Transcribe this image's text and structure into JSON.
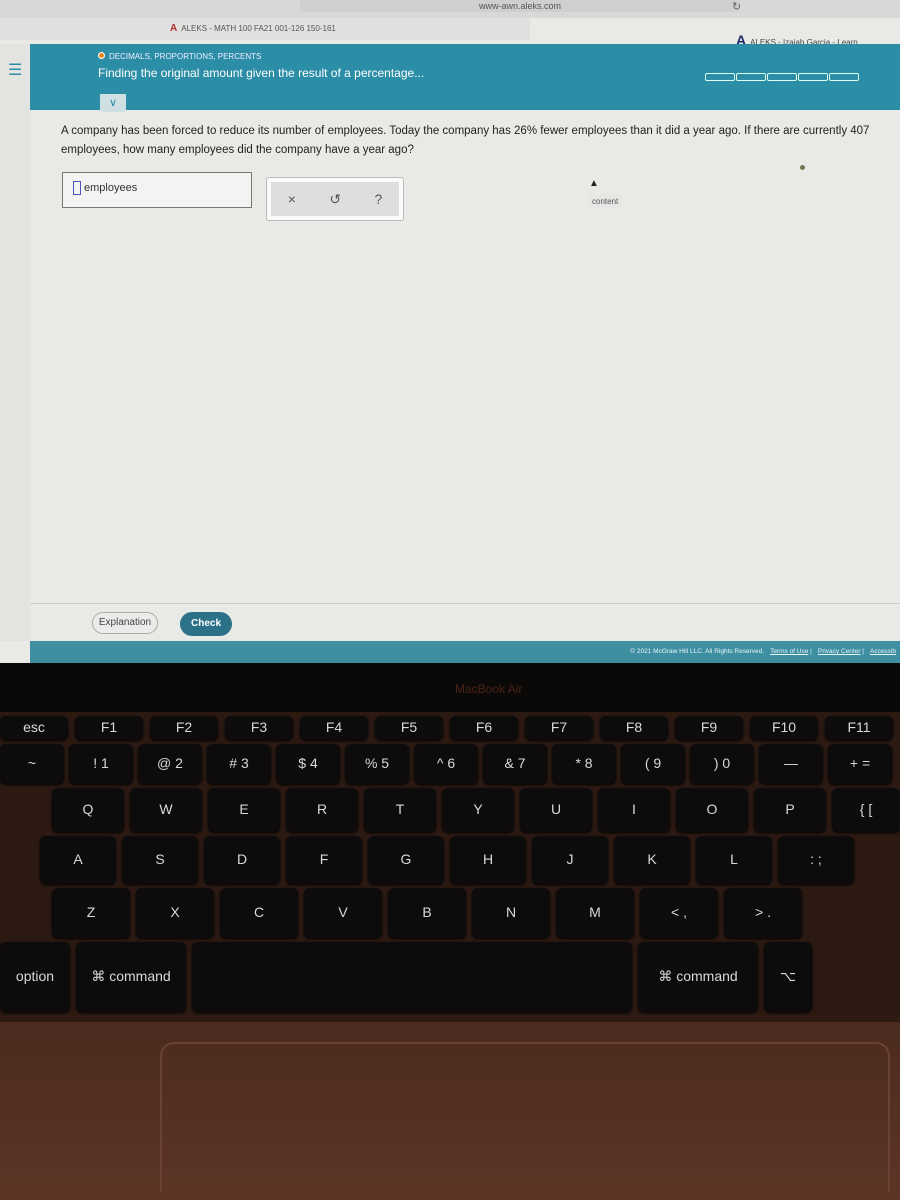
{
  "browser": {
    "url": "www-awn.aleks.com",
    "reload_icon": "reload-icon"
  },
  "tabs": [
    {
      "label": "ALEKS - MATH 100 FA21 001-126 150-161"
    },
    {
      "label": "ALEKS - Izaiah Garcia - Learn"
    }
  ],
  "header": {
    "topic": "DECIMALS, PROPORTIONS, PERCENTS",
    "lesson": "Finding the original amount given the result of a percentage...",
    "progress_segments": 5,
    "accent": "#2b8da6",
    "topic_dot_color": "#e88a1a"
  },
  "question": {
    "text": "A company has been forced to reduce its number of employees. Today the company has 26% fewer employees than it did a year ago. If there are currently 407 employees, how many employees did the company have a year ago?"
  },
  "answer": {
    "value": "",
    "unit": "employees"
  },
  "tools": {
    "clear": "×",
    "undo": "↺",
    "help": "?"
  },
  "tooltip": "content",
  "buttons": {
    "explanation": "Explanation",
    "check": "Check"
  },
  "footer": {
    "copyright": "© 2021 McGraw Hill LLC. All Rights Reserved.",
    "terms": "Terms of Use",
    "privacy": "Privacy Center",
    "accessibility": "Accessib"
  },
  "laptop": {
    "brand": "MacBook Air"
  },
  "keyboard": {
    "fn_row": [
      "esc",
      "F1",
      "F2",
      "F3",
      "F4",
      "F5",
      "F6",
      "F7",
      "F8",
      "F9",
      "F10",
      "F11"
    ],
    "number_row": [
      "~",
      "! 1",
      "@ 2",
      "# 3",
      "$ 4",
      "% 5",
      "^ 6",
      "& 7",
      "* 8",
      "( 9",
      ") 0",
      "—",
      "+ ="
    ],
    "q_row": [
      "Q",
      "W",
      "E",
      "R",
      "T",
      "Y",
      "U",
      "I",
      "O",
      "P",
      "{ ["
    ],
    "a_row": [
      "A",
      "S",
      "D",
      "F",
      "G",
      "H",
      "J",
      "K",
      "L",
      ": ;"
    ],
    "z_row": [
      "Z",
      "X",
      "C",
      "V",
      "B",
      "N",
      "M",
      "< ,",
      "> ."
    ],
    "bottom_row": [
      "option",
      "⌘ command",
      "",
      "⌘ command",
      "⌥"
    ]
  }
}
